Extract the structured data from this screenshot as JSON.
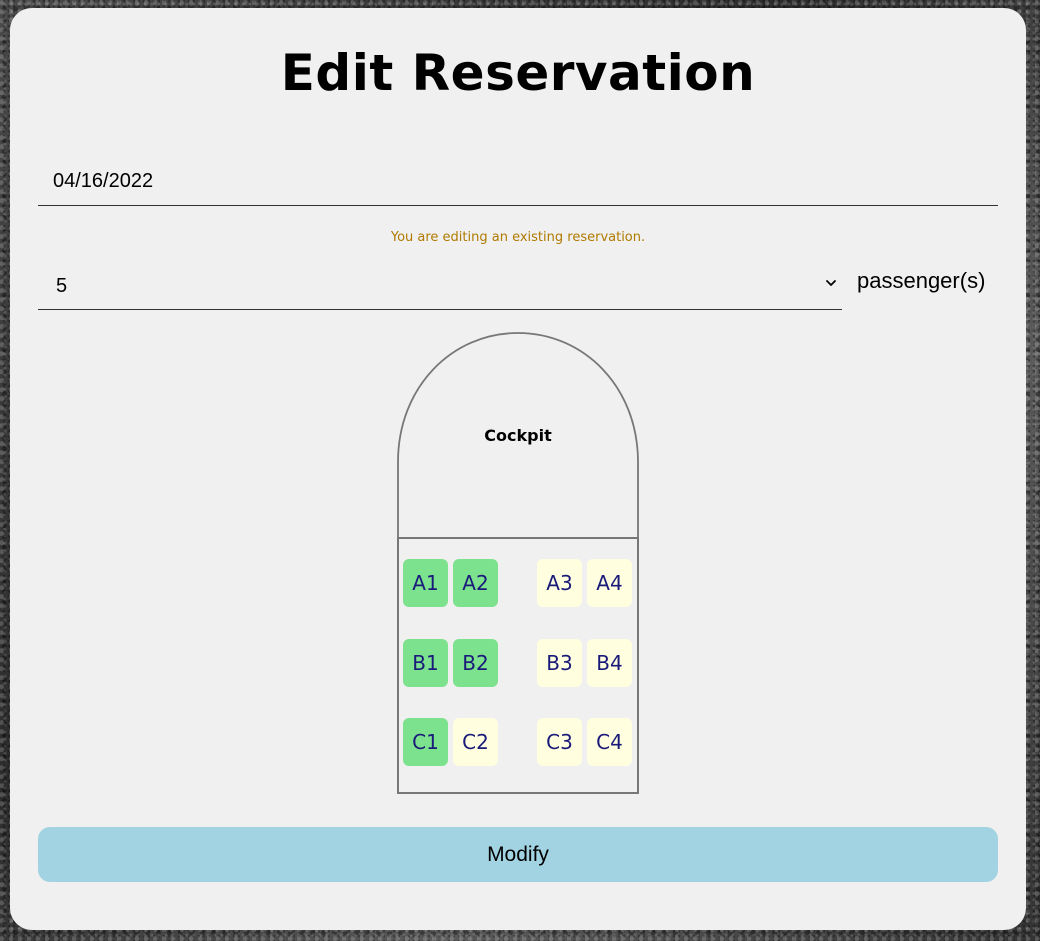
{
  "page": {
    "title": "Edit Reservation"
  },
  "date": {
    "value": "04/16/2022"
  },
  "notice": "You are editing an existing reservation.",
  "passengers": {
    "selected": "5",
    "label": "passenger(s)"
  },
  "plane": {
    "cockpit_label": "Cockpit",
    "seats": {
      "A1": {
        "label": "A1",
        "selected": true
      },
      "A2": {
        "label": "A2",
        "selected": true
      },
      "A3": {
        "label": "A3",
        "selected": false
      },
      "A4": {
        "label": "A4",
        "selected": false
      },
      "B1": {
        "label": "B1",
        "selected": true
      },
      "B2": {
        "label": "B2",
        "selected": true
      },
      "B3": {
        "label": "B3",
        "selected": false
      },
      "B4": {
        "label": "B4",
        "selected": false
      },
      "C1": {
        "label": "C1",
        "selected": true
      },
      "C2": {
        "label": "C2",
        "selected": false
      },
      "C3": {
        "label": "C3",
        "selected": false
      },
      "C4": {
        "label": "C4",
        "selected": false
      }
    }
  },
  "actions": {
    "modify_label": "Modify"
  },
  "colors": {
    "selected_seat": "#7de28d",
    "available_seat": "#ffffe0",
    "seat_text": "#1a1a7a",
    "notice_text": "#b07a00",
    "modify_button": "#a2d3e2",
    "card_background": "#f0f0f0"
  }
}
